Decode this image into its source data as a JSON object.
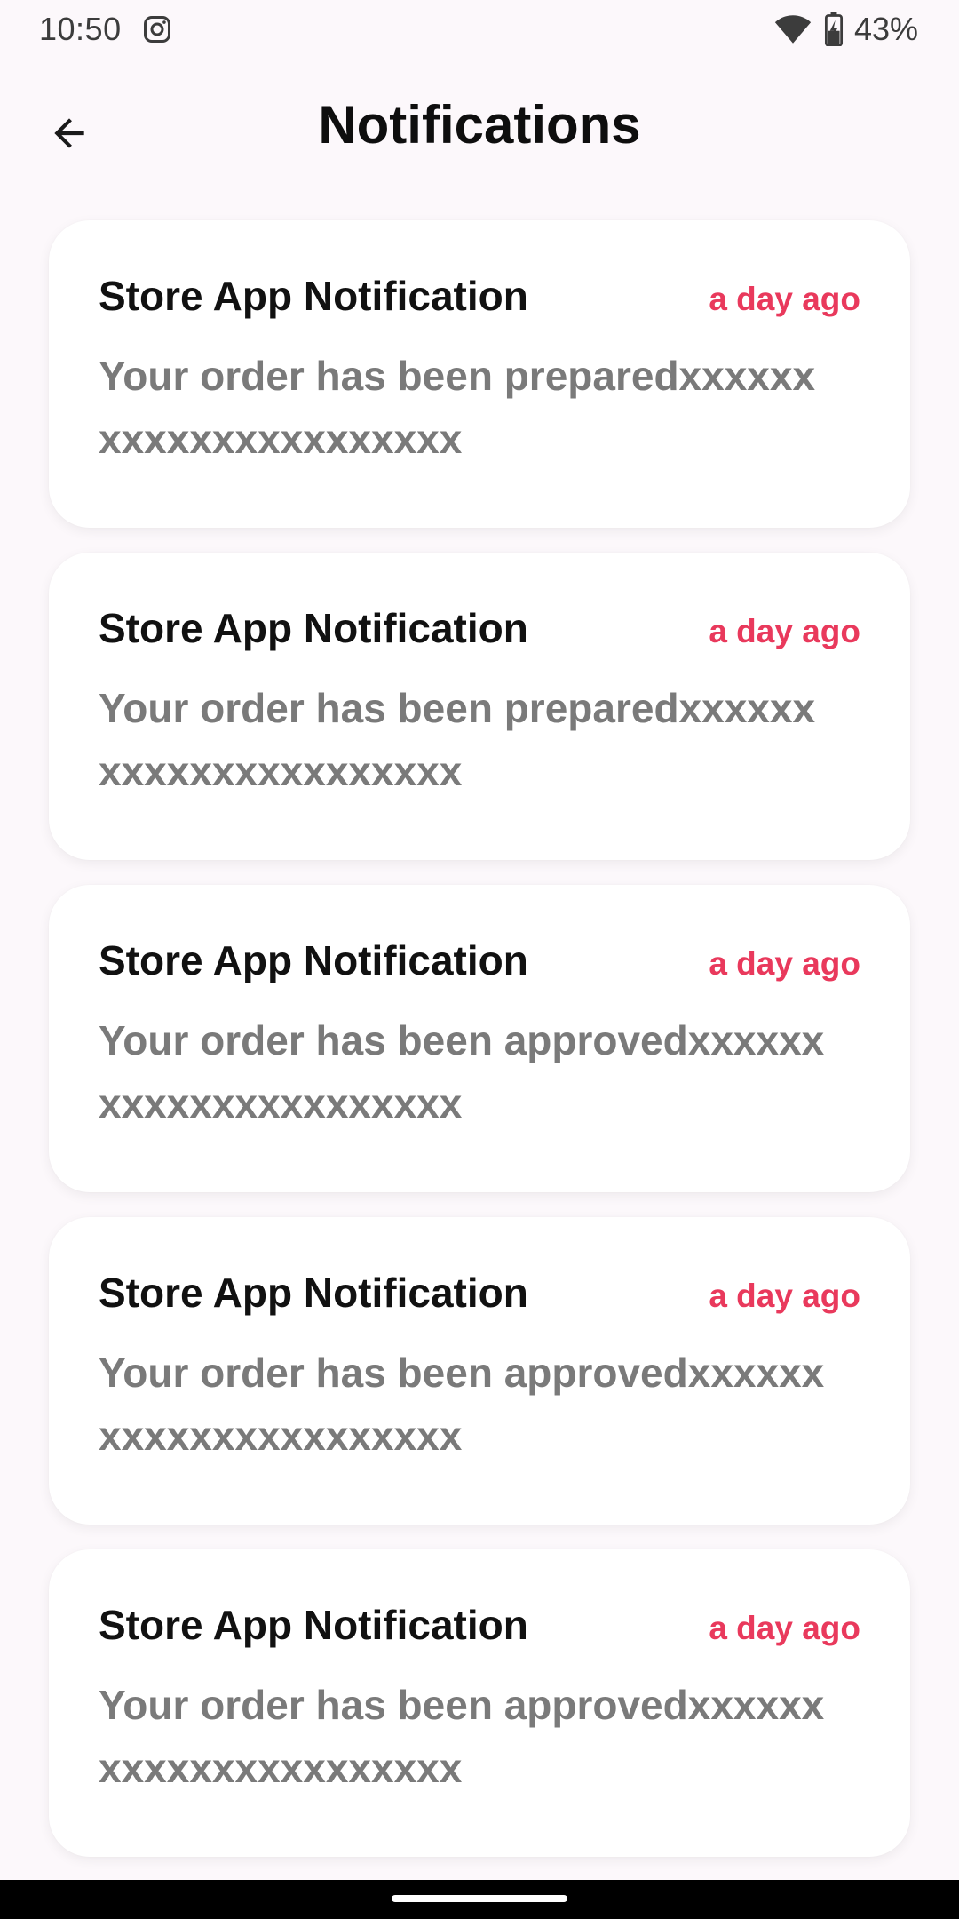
{
  "status_bar": {
    "time": "10:50",
    "battery": "43%"
  },
  "header": {
    "title": "Notifications"
  },
  "notifications": [
    {
      "title": "Store App Notification",
      "time": "a day ago",
      "body": "Your order has been preparedxxxxxxxxxxxxxxxxxxxxxx"
    },
    {
      "title": "Store App Notification",
      "time": "a day ago",
      "body": "Your order has been preparedxxxxxxxxxxxxxxxxxxxxxx"
    },
    {
      "title": "Store App Notification",
      "time": "a day ago",
      "body": "Your order has been approvedxxxxxxxxxxxxxxxxxxxxxx"
    },
    {
      "title": "Store App Notification",
      "time": "a day ago",
      "body": "Your order has been approvedxxxxxxxxxxxxxxxxxxxxxx"
    },
    {
      "title": "Store App Notification",
      "time": "a day ago",
      "body": "Your order has been approvedxxxxxxxxxxxxxxxxxxxxxx"
    }
  ],
  "colors": {
    "accent": "#e9395c",
    "background": "#fcf8fb",
    "card": "#ffffff",
    "body_text": "#7a7a7a"
  },
  "icons": {
    "back": "arrow-left-icon",
    "instagram": "instagram-icon",
    "wifi": "wifi-icon",
    "battery": "battery-charging-icon"
  }
}
